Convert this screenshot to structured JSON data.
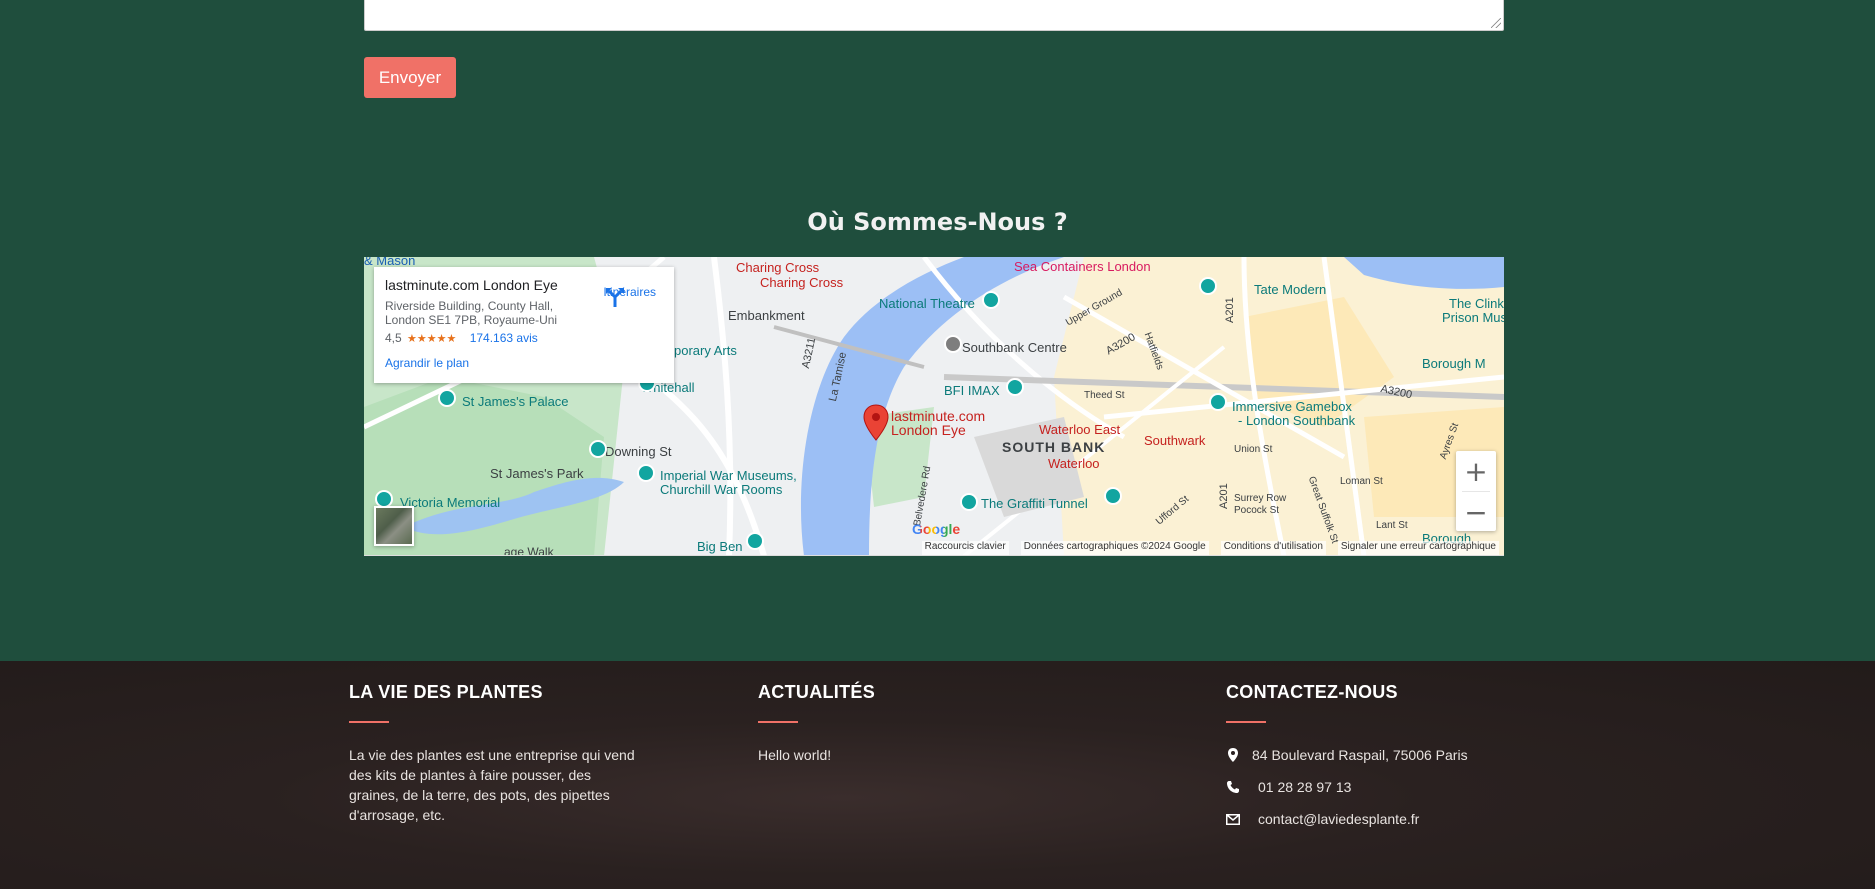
{
  "form": {
    "submit_label": "Envoyer"
  },
  "location_section": {
    "title": "Où Sommes-Nous ?"
  },
  "map": {
    "info_card": {
      "place_name": "lastminute.com London Eye",
      "address": "Riverside Building, County Hall, London SE1 7PB, Royaume-Uni",
      "rating": "4,5",
      "stars": "★★★★★",
      "reviews": "174.163 avis",
      "directions_label": "Itinéraires",
      "enlarge_label": "Agrandir le plan"
    },
    "marker_label_1": "lastminute.com",
    "marker_label_2": "London Eye",
    "labels": {
      "mason": "& Mason",
      "charing1": "Charing Cross",
      "charing2": "Charing Cross",
      "sea_containers": "Sea Containers London",
      "tate": "Tate Modern",
      "clink1": "The Clink",
      "clink2": "Prison Museum",
      "embankment": "Embankment",
      "national_theatre": "National Theatre",
      "contemporary": "porary Arts",
      "southbank_centre": "Southbank Centre",
      "whitehall": "Whitehall",
      "stjames_palace": "St James's Palace",
      "bfi": "BFI IMAX",
      "immersive1": "Immersive Gamebox",
      "immersive2": "- London Southbank",
      "borough_m": "Borough M",
      "waterloo_east": "Waterloo East",
      "south_bank": "SOUTH BANK",
      "southwark": "Southwark",
      "downing": "Downing St",
      "waterloo": "Waterloo",
      "stjames_park": "St James's Park",
      "iwm1": "Imperial War Museums,",
      "iwm2": "Churchill War Rooms",
      "graffiti": "The Graffiti Tunnel",
      "victoria": "Victoria Memorial",
      "big_ben": "Big Ben",
      "walk": "age Walk",
      "borough": "Borough",
      "river": "La Tamise",
      "a3211": "A3211",
      "a3200a": "A3200",
      "a3200b": "A3200",
      "a201a": "A201",
      "a201b": "A201",
      "upper_ground": "Upper Ground",
      "theed": "Theed St",
      "union": "Union St",
      "loman": "Loman St",
      "surrey_row": "Surrey Row",
      "pocock": "Pocock St",
      "ufford": "Ufford St",
      "lant": "Lant St",
      "hatfields": "Hatfields",
      "belvedere": "Belvedere Rd",
      "great_suffolk": "Great Suffolk St",
      "ayres": "Ayres St"
    },
    "zoom_in": "+",
    "zoom_out": "−",
    "google_logo": "Google",
    "attribution": {
      "shortcuts": "Raccourcis clavier",
      "data": "Données cartographiques ©2024 Google",
      "terms": "Conditions d'utilisation",
      "report": "Signaler une erreur cartographique"
    }
  },
  "footer": {
    "about": {
      "heading": "LA VIE DES PLANTES",
      "text": "La vie des plantes est une entreprise qui vend des kits de plantes à faire pousser, des graines, de la terre, des pots, des pipettes d'arrosage, etc."
    },
    "news": {
      "heading": "ACTUALITÉS",
      "item": "Hello world!"
    },
    "contact": {
      "heading": "CONTACTEZ-NOUS",
      "address": "84 Boulevard Raspail, 75006 Paris",
      "phone": "01 28 28 97 13",
      "email": "contact@laviedesplante.fr"
    }
  },
  "colors": {
    "page_bg": "#1f4e3d",
    "accent": "#f07167",
    "footer_bg": "#221b1a"
  }
}
